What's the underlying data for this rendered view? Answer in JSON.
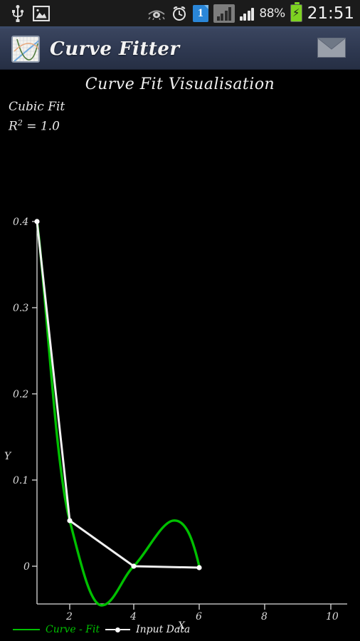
{
  "statusbar": {
    "left_icons": [
      "usb-icon",
      "screenshot-image-icon"
    ],
    "right_icons": [
      "smart-stay-eye-icon",
      "alarm-clock-icon"
    ],
    "notification_badge": "1",
    "battery_percent": "88%",
    "clock": "21:51"
  },
  "appbar": {
    "app_icon": "curve-graph-icon",
    "title": "Curve Fitter",
    "mail_icon": "envelope-icon"
  },
  "chart_data": {
    "type": "line",
    "title": "Curve Fit Visualisation",
    "xlabel": "X",
    "ylabel": "Y",
    "xlim": [
      0,
      11
    ],
    "ylim": [
      -0.045,
      0.435
    ],
    "xticks": [
      2,
      4,
      6,
      8,
      10
    ],
    "xticklabels": [
      "2",
      "4",
      "6",
      "8",
      "10"
    ],
    "yticks": [
      0,
      0.1,
      0.2,
      0.3,
      0.4
    ],
    "yticklabels": [
      "0",
      "0.1",
      "0.2",
      "0.3",
      "0.4"
    ],
    "grid": false,
    "legend_position": "below-axes-left",
    "annotations": [
      {
        "text": "Cubic Fit",
        "name": "fit-type-annotation"
      },
      {
        "text": "R² = 1.0",
        "name": "r-squared-annotation"
      }
    ],
    "series": [
      {
        "name": "Curve - Fit",
        "type": "line",
        "color": "#00c000",
        "marker": "none",
        "x": [
          1.0,
          1.25,
          1.5,
          1.75,
          2.0,
          2.25,
          2.5,
          2.75,
          3.0,
          3.25,
          3.5,
          3.75,
          4.0,
          4.25,
          4.5,
          4.75,
          5.0,
          5.25,
          5.5,
          5.75,
          6.0
        ],
        "y": [
          0.4,
          0.3035,
          0.2155,
          0.1395,
          0.0525,
          0.0225,
          -0.0075,
          -0.0215,
          -0.0265,
          -0.0215,
          -0.0105,
          0.0035,
          0.0,
          0.0115,
          0.0205,
          0.0255,
          0.0265,
          0.0265,
          0.0215,
          0.0135,
          0.0
        ]
      },
      {
        "name": "Input Data",
        "type": "line-marker",
        "color": "#f0f0f0",
        "marker": "circle",
        "x": [
          1.0,
          2.0,
          4.0,
          6.0
        ],
        "y": [
          0.4,
          0.0525,
          0.0,
          0.0
        ]
      }
    ],
    "legend": [
      {
        "label": "Curve - Fit",
        "color": "#00c000",
        "marker": "none"
      },
      {
        "label": "Input Data",
        "color": "#f0f0f0",
        "marker": "circle"
      }
    ]
  }
}
